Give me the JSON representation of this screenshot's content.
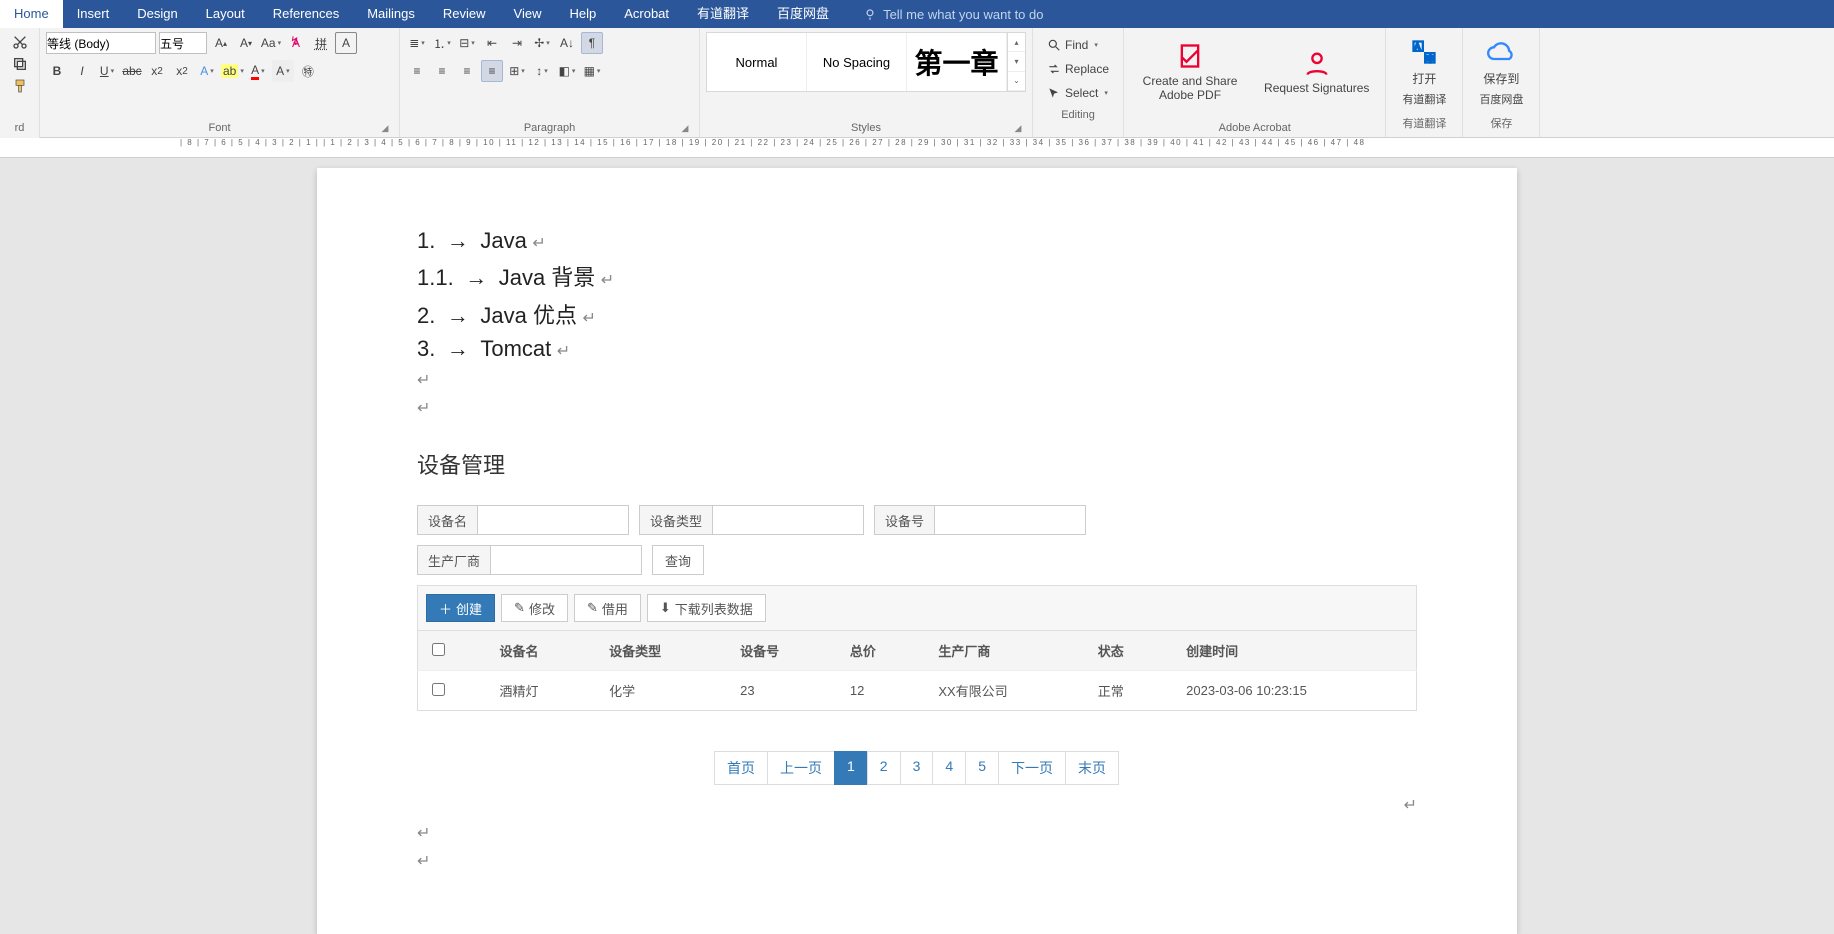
{
  "tabs": {
    "home": "Home",
    "insert": "Insert",
    "design": "Design",
    "layout": "Layout",
    "references": "References",
    "mailings": "Mailings",
    "review": "Review",
    "view": "View",
    "help": "Help",
    "acrobat": "Acrobat",
    "youdao": "有道翻译",
    "baidu": "百度网盘",
    "tell": "Tell me what you want to do"
  },
  "ribbon": {
    "clipboard_label": "rd",
    "font": {
      "name": "等线 (Body)",
      "size": "五号",
      "label": "Font"
    },
    "paragraph_label": "Paragraph",
    "styles": {
      "label": "Styles",
      "normal": "Normal",
      "nospacing": "No Spacing",
      "heading": "第一章"
    },
    "editing": {
      "label": "Editing",
      "find": "Find",
      "replace": "Replace",
      "select": "Select"
    },
    "acrobat": {
      "label": "Adobe Acrobat",
      "create": "Create and Share Adobe PDF",
      "request": "Request Signatures"
    },
    "youdao": {
      "label": "有道翻译",
      "open": "打开",
      "sub": "有道翻译"
    },
    "baidu": {
      "label": "保存",
      "save": "保存到",
      "sub": "百度网盘"
    }
  },
  "ruler_text": "| 8 | 7 | 6 | 5 | 4 | 3 | 2 | 1 |    | 1 | 2 | 3 | 4 | 5 | 6 | 7 | 8 | 9 | 10 | 11 | 12 | 13 | 14 | 15 | 16 | 17 | 18 | 19 | 20 | 21 | 22 | 23 | 24 | 25 | 26 | 27 | 28 | 29 | 30 | 31 | 32 | 33 | 34 | 35 | 36 | 37 | 38 | 39 | 40 | 41 | 42 | 43 | 44 | 45 | 46 | 47 | 48",
  "document": {
    "lines": [
      {
        "num": "1.",
        "text": "Java"
      },
      {
        "num": "1.1.",
        "text": "Java 背景"
      },
      {
        "num": "2.",
        "text": "Java 优点"
      },
      {
        "num": "3.",
        "text": "Tomcat"
      }
    ]
  },
  "web": {
    "title": "设备管理",
    "filters": {
      "name": "设备名",
      "type": "设备类型",
      "no": "设备号",
      "maker": "生产厂商",
      "search": "查询"
    },
    "toolbar": {
      "create": "创建",
      "edit": "修改",
      "borrow": "借用",
      "download": "下载列表数据"
    },
    "headers": {
      "name": "设备名",
      "type": "设备类型",
      "no": "设备号",
      "total": "总价",
      "maker": "生产厂商",
      "status": "状态",
      "created": "创建时间"
    },
    "row": {
      "name": "酒精灯",
      "type": "化学",
      "no": "23",
      "total": "12",
      "maker": "XX有限公司",
      "status": "正常",
      "created": "2023-03-06 10:23:15"
    },
    "pager": {
      "first": "首页",
      "prev": "上一页",
      "p1": "1",
      "p2": "2",
      "p3": "3",
      "p4": "4",
      "p5": "5",
      "next": "下一页",
      "last": "末页"
    }
  }
}
